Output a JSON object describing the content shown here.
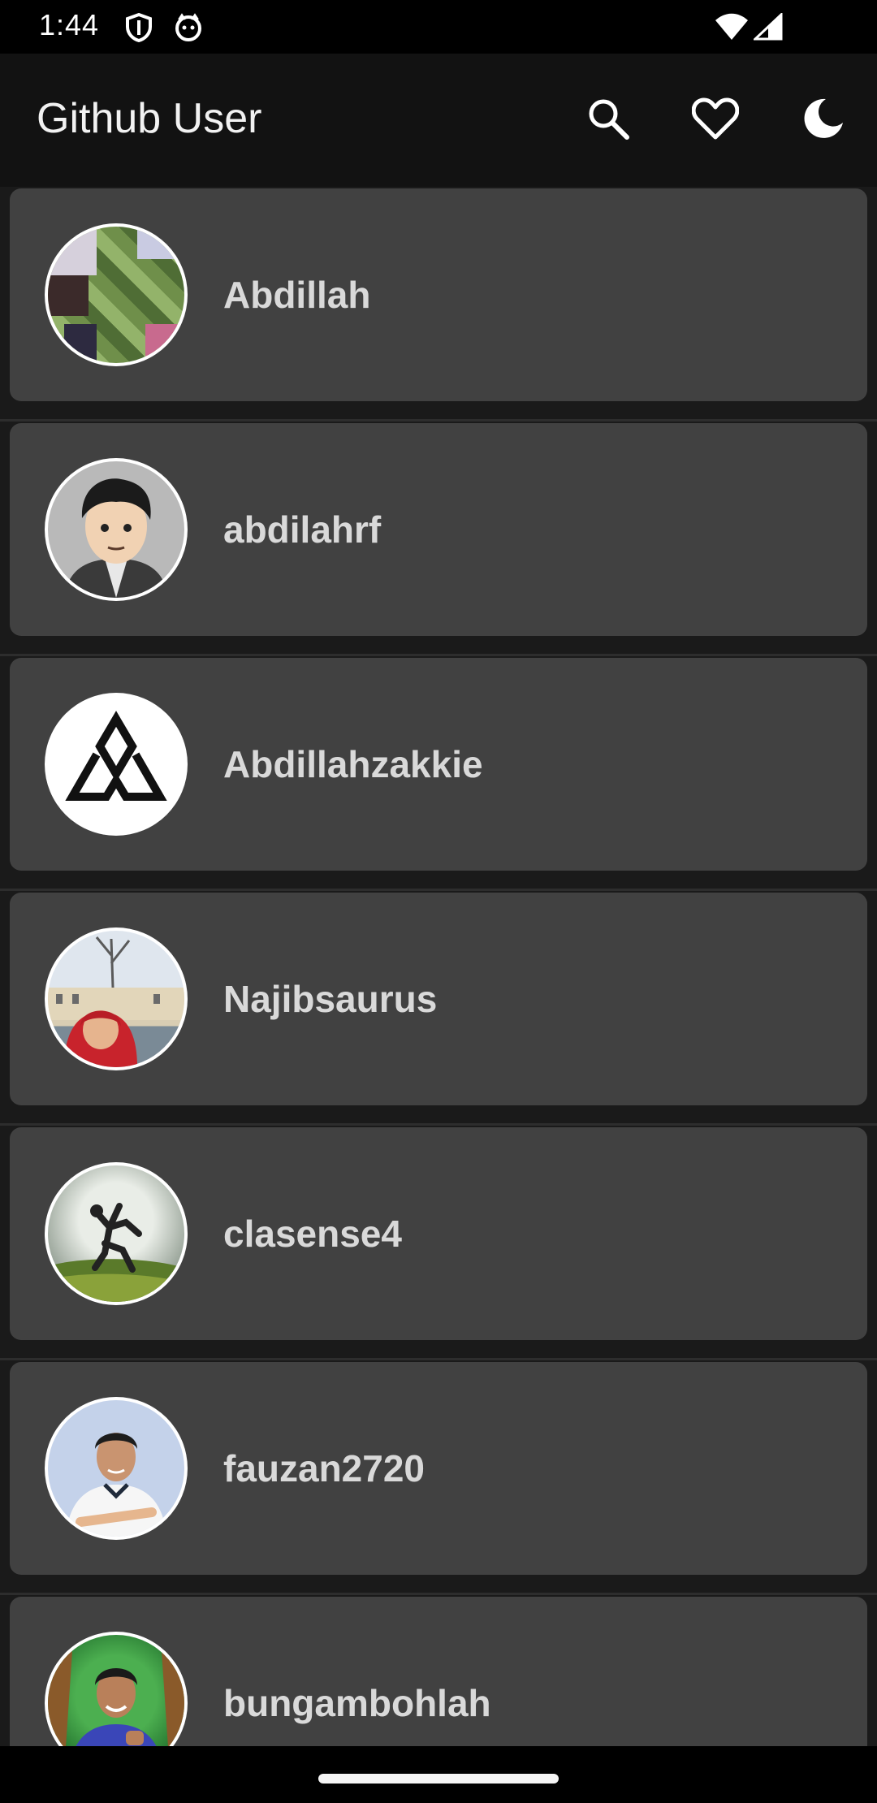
{
  "status_bar": {
    "time": "1:44",
    "icons": [
      "shield-icon",
      "cat-face-icon",
      "wifi-icon",
      "cellular-signal-icon"
    ]
  },
  "app_bar": {
    "title": "Github User",
    "actions": [
      "search-icon",
      "heart-icon",
      "moon-icon"
    ]
  },
  "users": [
    {
      "username": "Abdillah"
    },
    {
      "username": "abdilahrf"
    },
    {
      "username": "Abdillahzakkie"
    },
    {
      "username": "Najibsaurus"
    },
    {
      "username": "clasense4"
    },
    {
      "username": "fauzan2720"
    },
    {
      "username": "bungambohlah"
    }
  ],
  "colors": {
    "background": "#1a1a1a",
    "app_bar": "#121212",
    "card": "#414141",
    "text": "#d9d9d9"
  }
}
